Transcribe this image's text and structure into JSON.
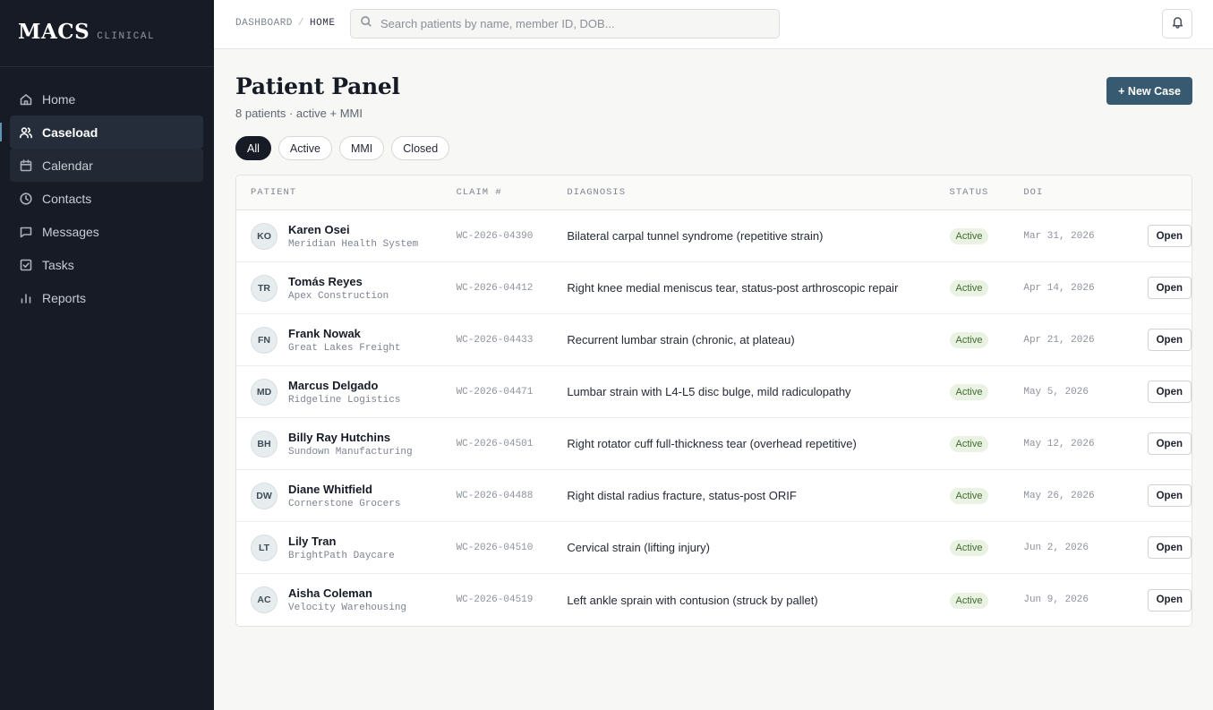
{
  "brand": {
    "logo": "MACS",
    "sub": "CLINICAL"
  },
  "sidebar": {
    "items": [
      {
        "label": "Home",
        "icon": "home-icon",
        "state": ""
      },
      {
        "label": "Caseload",
        "icon": "users-icon",
        "state": "active"
      },
      {
        "label": "Calendar",
        "icon": "calendar-icon",
        "state": "hover"
      },
      {
        "label": "Contacts",
        "icon": "clock-icon",
        "state": ""
      },
      {
        "label": "Messages",
        "icon": "message-icon",
        "state": ""
      },
      {
        "label": "Tasks",
        "icon": "checkbox-icon",
        "state": ""
      },
      {
        "label": "Reports",
        "icon": "bar-chart-icon",
        "state": ""
      }
    ]
  },
  "topbar": {
    "breadcrumb": [
      "DASHBOARD",
      "HOME"
    ],
    "search_placeholder": "Search patients by name, member ID, DOB..."
  },
  "main": {
    "title": "Patient Panel",
    "subtitle": "8 patients · active + MMI",
    "new_case_label": "+ New Case",
    "filters": [
      {
        "label": "All",
        "selected": true
      },
      {
        "label": "Active",
        "selected": false
      },
      {
        "label": "MMI",
        "selected": false
      },
      {
        "label": "Closed",
        "selected": false
      }
    ]
  },
  "table": {
    "headers": {
      "patient": "PATIENT",
      "claim": "CLAIM #",
      "diagnosis": "DIAGNOSIS",
      "status": "STATUS",
      "doi": "DOI"
    },
    "open_label": "Open",
    "rows": [
      {
        "initials": "KO",
        "name": "Karen Osei",
        "employer": "Meridian Health System",
        "claim": "WC-2026-04390",
        "diagnosis": "Bilateral carpal tunnel syndrome (repetitive strain)",
        "status": "Active",
        "doi": "Mar 31, 2026"
      },
      {
        "initials": "TR",
        "name": "Tomás Reyes",
        "employer": "Apex Construction",
        "claim": "WC-2026-04412",
        "diagnosis": "Right knee medial meniscus tear, status-post arthroscopic repair",
        "status": "Active",
        "doi": "Apr 14, 2026"
      },
      {
        "initials": "FN",
        "name": "Frank Nowak",
        "employer": "Great Lakes Freight",
        "claim": "WC-2026-04433",
        "diagnosis": "Recurrent lumbar strain (chronic, at plateau)",
        "status": "Active",
        "doi": "Apr 21, 2026"
      },
      {
        "initials": "MD",
        "name": "Marcus Delgado",
        "employer": "Ridgeline Logistics",
        "claim": "WC-2026-04471",
        "diagnosis": "Lumbar strain with L4-L5 disc bulge, mild radiculopathy",
        "status": "Active",
        "doi": "May 5, 2026"
      },
      {
        "initials": "BH",
        "name": "Billy Ray Hutchins",
        "employer": "Sundown Manufacturing",
        "claim": "WC-2026-04501",
        "diagnosis": "Right rotator cuff full-thickness tear (overhead repetitive)",
        "status": "Active",
        "doi": "May 12, 2026"
      },
      {
        "initials": "DW",
        "name": "Diane Whitfield",
        "employer": "Cornerstone Grocers",
        "claim": "WC-2026-04488",
        "diagnosis": "Right distal radius fracture, status-post ORIF",
        "status": "Active",
        "doi": "May 26, 2026"
      },
      {
        "initials": "LT",
        "name": "Lily Tran",
        "employer": "BrightPath Daycare",
        "claim": "WC-2026-04510",
        "diagnosis": "Cervical strain (lifting injury)",
        "status": "Active",
        "doi": "Jun 2, 2026"
      },
      {
        "initials": "AC",
        "name": "Aisha Coleman",
        "employer": "Velocity Warehousing",
        "claim": "WC-2026-04519",
        "diagnosis": "Left ankle sprain with contusion (struck by pallet)",
        "status": "Active",
        "doi": "Jun 9, 2026"
      }
    ]
  }
}
